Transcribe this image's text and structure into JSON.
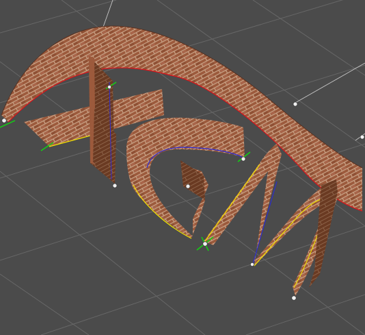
{
  "viewport": {
    "background": "#4b4b4b",
    "grid_color": "#6a6a6a",
    "helper_line_color": "#bfbfbf",
    "brick_colors": {
      "face": "#9c5a3c",
      "mortar": "#d9b79a",
      "side": "#6a3a22",
      "dark": "#3b2416"
    },
    "spline_colors": {
      "outer": "#e0121a",
      "inner": "#2c2cd8",
      "bottom": "#f2e400"
    },
    "gizmo_colors": {
      "handle": "#f0f0f0",
      "axis": "#12d212"
    }
  }
}
